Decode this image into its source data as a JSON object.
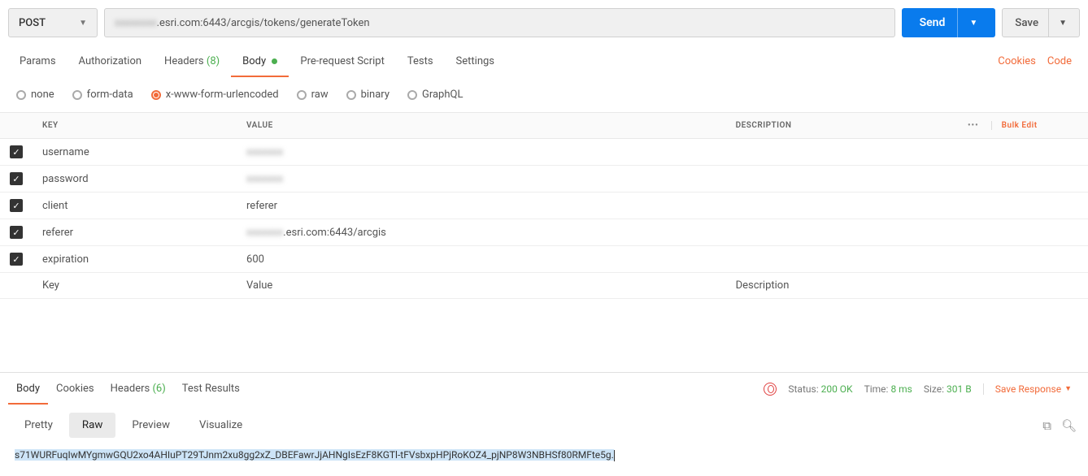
{
  "request": {
    "method": "POST",
    "url_hidden": "———.esri.com:6443/arcgis/tokens/generateToken",
    "url_visible_suffix": ".esri.com:6443/arcgis/tokens/generateToken"
  },
  "buttons": {
    "send": "Send",
    "save": "Save"
  },
  "tabs": {
    "params": "Params",
    "authorization": "Authorization",
    "headers": "Headers",
    "headers_count": "(8)",
    "body": "Body",
    "prerequest": "Pre-request Script",
    "tests": "Tests",
    "settings": "Settings"
  },
  "tab_links": {
    "cookies": "Cookies",
    "code": "Code"
  },
  "body_types": {
    "none": "none",
    "formdata": "form-data",
    "urlencoded": "x-www-form-urlencoded",
    "raw": "raw",
    "binary": "binary",
    "graphql": "GraphQL"
  },
  "table": {
    "headers": {
      "key": "KEY",
      "value": "VALUE",
      "description": "DESCRIPTION"
    },
    "bulk_edit": "Bulk Edit",
    "rows": [
      {
        "key": "username",
        "value": "",
        "value_blurred": true
      },
      {
        "key": "password",
        "value": "",
        "value_blurred": true
      },
      {
        "key": "client",
        "value": "referer"
      },
      {
        "key": "referer",
        "value": ".esri.com:6443/arcgis",
        "value_prefix_blurred": true
      },
      {
        "key": "expiration",
        "value": "600"
      }
    ],
    "placeholders": {
      "key": "Key",
      "value": "Value",
      "description": "Description"
    }
  },
  "response": {
    "tabs": {
      "body": "Body",
      "cookies": "Cookies",
      "headers": "Headers",
      "headers_count": "(6)",
      "tests": "Test Results"
    },
    "status_label": "Status:",
    "status_value": "200 OK",
    "time_label": "Time:",
    "time_value": "8 ms",
    "size_label": "Size:",
    "size_value": "301 B",
    "save_response": "Save Response",
    "views": {
      "pretty": "Pretty",
      "raw": "Raw",
      "preview": "Preview",
      "visualize": "Visualize"
    },
    "body_text": "s71WURFuqIwMYgmwGQU2xo4AHIuPT29TJnm2xu8gg2xZ_DBEFawrJjAHNgIsEzF8KGTl-tFVsbxpHPjRoKOZ4_pjNP8W3NBHSf80RMFte5g."
  }
}
